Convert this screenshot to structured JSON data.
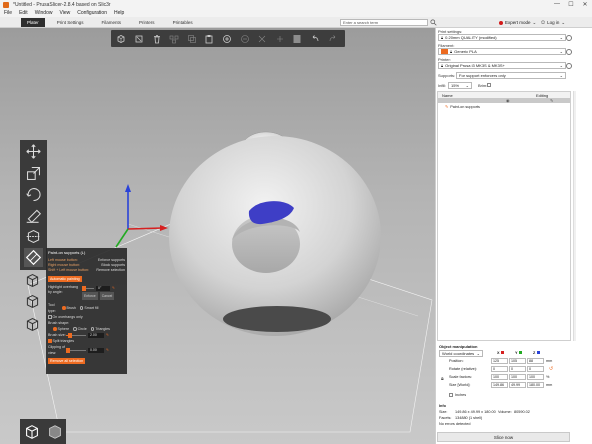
{
  "window": {
    "title": "*Untitled - PrusaSlicer-2.8.4 based on Slic3r",
    "controls": [
      "—",
      "☐",
      "✕"
    ]
  },
  "menu": [
    "File",
    "Edit",
    "Window",
    "View",
    "Configuration",
    "Help"
  ],
  "tabs": [
    {
      "label": "Plater",
      "active": true
    },
    {
      "label": "Print Settings",
      "active": false
    },
    {
      "label": "Filaments",
      "active": false
    },
    {
      "label": "Printers",
      "active": false
    },
    {
      "label": "Printables",
      "active": false
    }
  ],
  "search": {
    "placeholder": "Enter a search term"
  },
  "mode": {
    "label": "Expert mode",
    "color": "#d21a1a"
  },
  "account": {
    "label": "Log in"
  },
  "top_toolbar_icons": [
    "add-icon",
    "delete-icon",
    "delete-all-icon",
    "arrange-icon",
    "copy-icon",
    "paste-icon",
    "add-instance-icon",
    "remove-instance-icon",
    "split-objects-icon",
    "split-parts-icon",
    "variable-layer-icon",
    "undo-icon",
    "redo-icon"
  ],
  "left_toolbar_icons": [
    "move-icon",
    "scale-icon",
    "rotate-icon",
    "place-on-face-icon",
    "cut-icon",
    "paint-supports-icon",
    "seam-painting-icon",
    "mmu-painting-icon",
    "measure-icon"
  ],
  "paint_panel": {
    "title": "Paint-on supports (L)",
    "shortcuts": [
      {
        "key": "Left mouse button:",
        "action": "Enforce supports"
      },
      {
        "key": "Right mouse button:",
        "action": "Block supports"
      },
      {
        "key": "Shift + Left mouse button:",
        "action": "Remove selection"
      }
    ],
    "auto_paint": "Automatic painting",
    "highlight_label": "Highlight overhang by angle:",
    "highlight_value": "0°",
    "enforce_btn": "Enforce",
    "cancel_btn": "Cancel",
    "tool_type_label": "Tool type:",
    "tool_brush": "Brush",
    "tool_smartfill": "Smart fill",
    "on_overhangs": "On overhangs only",
    "brush_shape_label": "Brush shape:",
    "shape_sphere": "Sphere",
    "shape_circle": "Circle",
    "shape_triangles": "Triangles",
    "brush_size_label": "Brush size:",
    "brush_size_value": "2.00",
    "split_triangles": "Split triangles",
    "clipping_label": "Clipping of view:",
    "clipping_value": "0.00",
    "remove_all": "Remove all selection"
  },
  "sidebar": {
    "print_settings_label": "Print settings:",
    "print_profile": "0.20mm QUALITY (modified)",
    "filament_label": "Filament:",
    "filament_profile": "Generic PLA",
    "filament_color": "#ed6b21",
    "printer_label": "Printer:",
    "printer_profile": "Original Prusa i3 MK3S & MK3S+",
    "supports_label": "Supports:",
    "supports_value": "For support enforcers only",
    "infill_label": "Infill:",
    "infill_value": "15%",
    "brim_label": "Brim:",
    "list_headers": {
      "name": "Name",
      "editing": "Editing"
    },
    "list_items": [
      "Paint-on supports"
    ]
  },
  "object_manipulation": {
    "title": "Object manipulation",
    "coord_system": "World coordinates",
    "axes": [
      "X",
      "Y",
      "Z"
    ],
    "position_label": "Position:",
    "position": [
      "125",
      "105",
      "88"
    ],
    "rotate_label": "Rotate (relative):",
    "rotate": [
      "0",
      "0",
      "0"
    ],
    "scale_label": "Scale factors:",
    "scale": [
      "100",
      "100",
      "100"
    ],
    "size_label": "Size [World]:",
    "size": [
      "149.86",
      "49.99",
      "180.00"
    ],
    "unit_mm": "mm",
    "unit_pct": "%",
    "inches_label": "Inches"
  },
  "info": {
    "title": "Info",
    "size_label": "Size:",
    "size_value": "149.86 x 49.99 x 180.00",
    "volume_label": "Volume:",
    "volume_value": "80590.02",
    "facets_label": "Facets:",
    "facets_value": "134880 (1 shell)",
    "errors": "No errors detected"
  },
  "slice_button": "Slice now"
}
